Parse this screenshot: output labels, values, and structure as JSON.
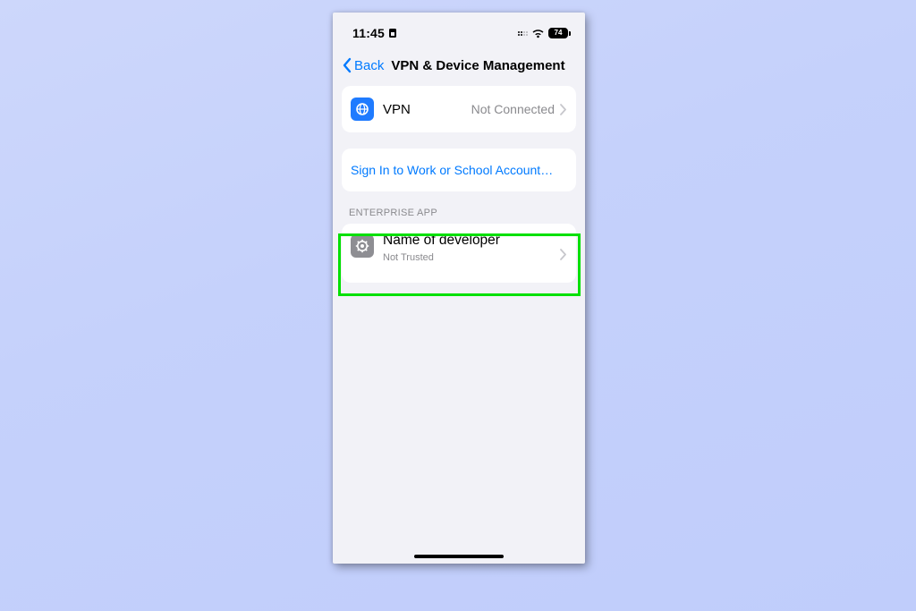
{
  "statusbar": {
    "time": "11:45",
    "battery_percent": "74"
  },
  "nav": {
    "back_label": "Back",
    "title": "VPN & Device Management"
  },
  "vpn_row": {
    "label": "VPN",
    "status": "Not Connected"
  },
  "signin_row": {
    "label": "Sign In to Work or School Account…"
  },
  "enterprise": {
    "section_header": "ENTERPRISE APP",
    "developer_name": "Name of developer",
    "trust_status": "Not Trusted"
  },
  "highlight": {
    "color": "#00e000"
  }
}
